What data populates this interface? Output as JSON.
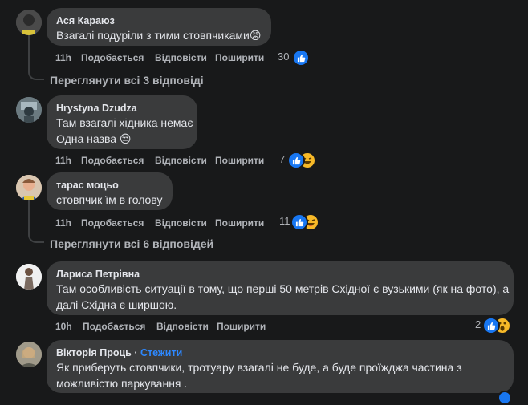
{
  "comments": [
    {
      "author": "Ася Караюз",
      "lines": [
        "Взагалі подуріли з тими стовпчиками😡"
      ],
      "time": "11h",
      "like": "Подобається",
      "reply": "Відповісти",
      "share": "Поширити",
      "reaction_count": "30",
      "reactions": [
        "like-icon"
      ],
      "view_replies": "Переглянути всі 3 відповіді"
    },
    {
      "author": "Hrystyna Dzudza",
      "lines": [
        "Там взагалі хідника немає",
        "Одна назва 😒"
      ],
      "time": "11h",
      "like": "Подобається",
      "reply": "Відповісти",
      "share": "Поширити",
      "reaction_count": "7",
      "reactions": [
        "like-icon",
        "laugh-icon"
      ]
    },
    {
      "author": "тарас моцьо",
      "lines": [
        "стовпчик їм в голову"
      ],
      "time": "11h",
      "like": "Подобається",
      "reply": "Відповісти",
      "share": "Поширити",
      "reaction_count": "11",
      "reactions": [
        "like-icon",
        "laugh-icon"
      ],
      "view_replies": "Переглянути всі 6 відповідей"
    },
    {
      "author": "Лариса Петрівна",
      "lines": [
        "Там особливість ситуації в тому, що перші 50 метрів Східної є вузькими (як на фото), а",
        "далі Східна є ширшою."
      ],
      "time": "10h",
      "like": "Подобається",
      "reply": "Відповісти",
      "share": "Поширити",
      "reaction_count": "2",
      "reactions": [
        "like-icon",
        "wow-icon"
      ]
    },
    {
      "author": "Вікторія Проць",
      "follow": "Стежити",
      "lines": [
        "Як приберуть стовпчики, тротуару взагалі не буде, а буде проїжджа частина з",
        "можливістю паркування ."
      ]
    }
  ],
  "colors": {
    "background": "#18191a",
    "bubble": "#3a3b3c",
    "like_blue": "#1877f2",
    "follow_blue": "#2d88ff",
    "emoji_yellow": "#f7b928"
  }
}
